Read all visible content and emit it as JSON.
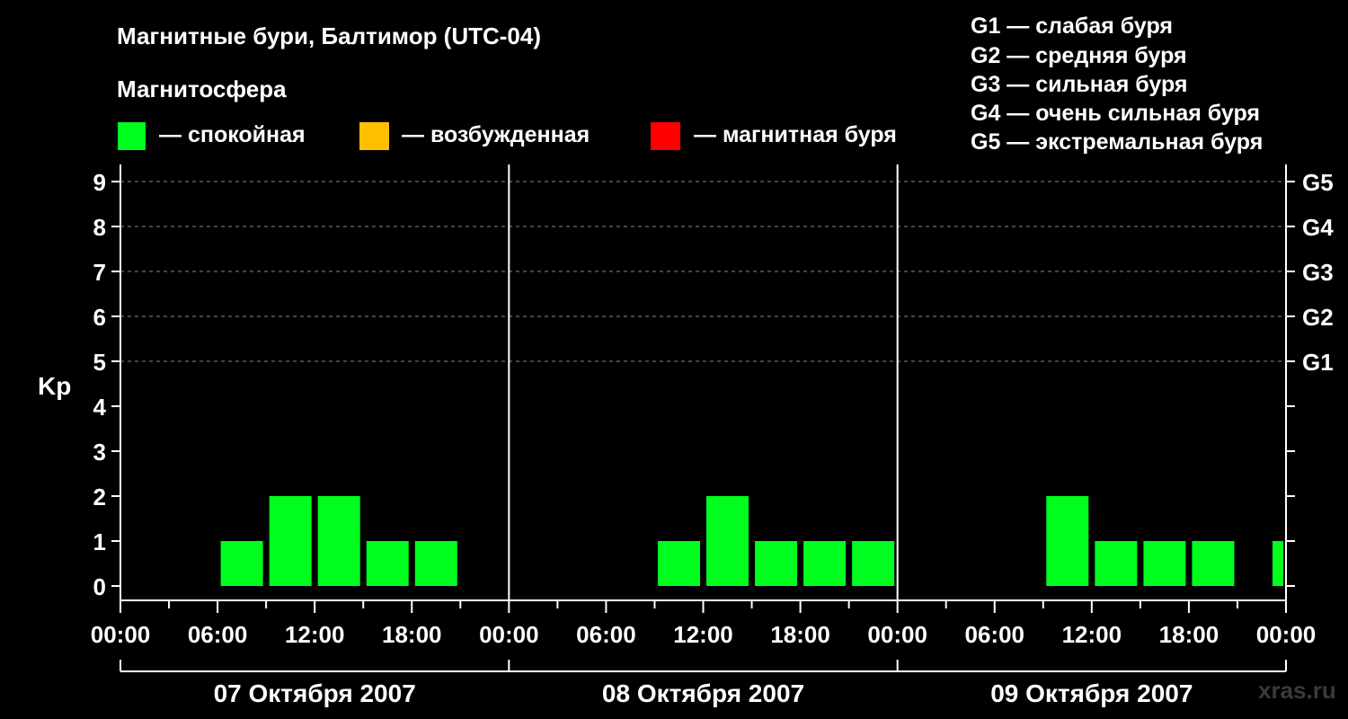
{
  "chart_data": {
    "type": "bar",
    "title": "Магнитные бури, Балтимор (UTC-04)",
    "subtitle": "Магнитосфера",
    "ylabel": "Kp",
    "ylim": [
      0,
      9
    ],
    "y_ticks": [
      "0",
      "1",
      "2",
      "3",
      "4",
      "5",
      "6",
      "7",
      "8",
      "9"
    ],
    "storm_levels": [
      {
        "kp": 5,
        "label": "G1"
      },
      {
        "kp": 6,
        "label": "G2"
      },
      {
        "kp": 7,
        "label": "G3"
      },
      {
        "kp": 8,
        "label": "G4"
      },
      {
        "kp": 9,
        "label": "G5"
      }
    ],
    "storm_legend": [
      "G1 — слабая буря",
      "G2 — средняя буря",
      "G3 — сильная буря",
      "G4 — очень сильная буря",
      "G5 — экстремальная буря"
    ],
    "color_legend": [
      {
        "label": "— спокойная",
        "color": "#00ff1e"
      },
      {
        "label": "— возбужденная",
        "color": "#ffc000"
      },
      {
        "label": "— магнитная буря",
        "color": "#ff0000"
      }
    ],
    "x_tick_labels": [
      "00:00",
      "06:00",
      "12:00",
      "18:00",
      "00:00",
      "06:00",
      "12:00",
      "18:00",
      "00:00",
      "06:00",
      "12:00",
      "18:00",
      "00:00"
    ],
    "days": [
      "07 Октября 2007",
      "08 Октября 2007",
      "09 Октября 2007"
    ],
    "interval_hours": 3,
    "series": [
      {
        "values": [
          0,
          0,
          1,
          2,
          2,
          1,
          1,
          0,
          0,
          0,
          0,
          1,
          2,
          1,
          1,
          1,
          0,
          0,
          0,
          2,
          1,
          1,
          1,
          1
        ]
      }
    ],
    "bar_color": "#00ff1e",
    "grid": "dashed at Kp 5–9",
    "watermark": "xras.ru"
  }
}
